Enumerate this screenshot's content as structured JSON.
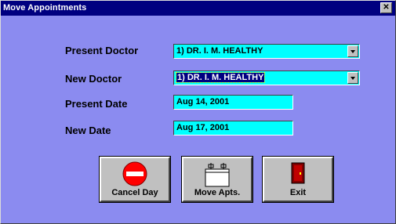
{
  "window": {
    "title": "Move Appointments",
    "close_glyph": "✕"
  },
  "form": {
    "present_doctor_label": "Present Doctor",
    "present_doctor_value": "1) DR. I. M. HEALTHY",
    "new_doctor_label": "New Doctor",
    "new_doctor_value": "1) DR. I. M. HEALTHY",
    "present_date_label": "Present Date",
    "present_date_value": "Aug 14, 2001",
    "new_date_label": "New Date",
    "new_date_value": "Aug 17, 2001"
  },
  "buttons": {
    "cancel_day_label": "Cancel Day",
    "move_apts_label": "Move Apts.",
    "exit_label": "Exit"
  },
  "icons": {
    "cancel_day": "no-entry-icon",
    "move_apts": "folder-icon",
    "exit": "door-icon"
  },
  "colors": {
    "window_bg": "#8b8bf0",
    "title_bar": "#000080",
    "field_bg": "#00ffff",
    "button_face": "#c0c0c0"
  }
}
